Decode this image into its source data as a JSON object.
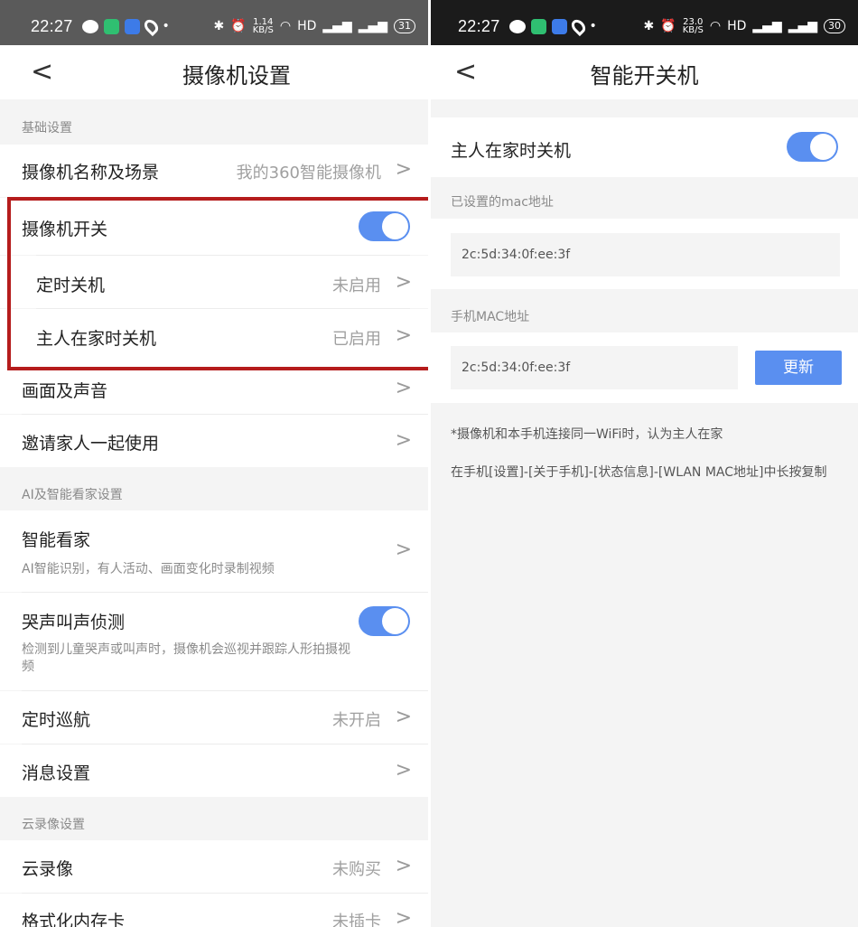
{
  "left": {
    "status": {
      "time": "22:27",
      "speed": "1.14",
      "speed_unit": "KB/S",
      "network": "HD",
      "battery": "31"
    },
    "nav": {
      "back": "<",
      "title": "摄像机设置"
    },
    "sections": {
      "basic": "基础设置",
      "ai": "AI及智能看家设置",
      "cloud": "云录像设置"
    },
    "rows": {
      "camera_name": {
        "label": "摄像机名称及场景",
        "value": "我的360智能摄像机"
      },
      "camera_switch": {
        "label": "摄像机开关",
        "toggle_on": true
      },
      "timer_off": {
        "label": "定时关机",
        "value": "未启用"
      },
      "owner_home_off": {
        "label": "主人在家时关机",
        "value": "已启用"
      },
      "picture_sound": {
        "label": "画面及声音"
      },
      "invite_family": {
        "label": "邀请家人一起使用"
      },
      "smart_home": {
        "label": "智能看家",
        "desc": "AI智能识别，有人活动、画面变化时录制视频"
      },
      "cry_detect": {
        "label": "哭声叫声侦测",
        "desc": "检测到儿童哭声或叫声时，摄像机会巡视并跟踪人形拍摄视频",
        "toggle_on": true
      },
      "timed_patrol": {
        "label": "定时巡航",
        "value": "未开启"
      },
      "message_settings": {
        "label": "消息设置"
      },
      "cloud_record": {
        "label": "云录像",
        "value": "未购买"
      },
      "format_sd": {
        "label": "格式化内存卡",
        "value": "未插卡"
      }
    },
    "chevron": ">"
  },
  "right": {
    "status": {
      "time": "22:27",
      "speed": "23.0",
      "speed_unit": "KB/S",
      "network": "HD",
      "battery": "30"
    },
    "nav": {
      "back": "<",
      "title": "智能开关机"
    },
    "owner_home_off": {
      "label": "主人在家时关机",
      "toggle_on": true
    },
    "set_mac_label": "已设置的mac地址",
    "set_mac_value": "2c:5d:34:0f:ee:3f",
    "phone_mac_label": "手机MAC地址",
    "phone_mac_value": "2c:5d:34:0f:ee:3f",
    "update_button": "更新",
    "note_1": "*摄像机和本手机连接同一WiFi时，认为主人在家",
    "note_2": "在手机[设置]-[关于手机]-[状态信息]-[WLAN MAC地址]中长按复制"
  },
  "colors": {
    "accent": "#5a8ff0",
    "highlight": "#b51c1c",
    "muted": "#a0a0a0"
  }
}
